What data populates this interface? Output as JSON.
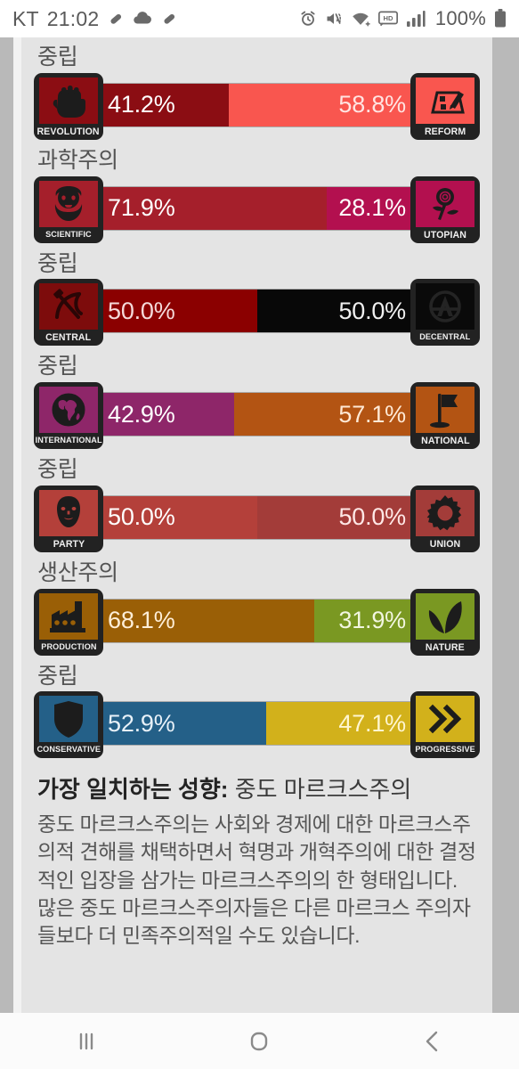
{
  "status_bar": {
    "carrier": "KT",
    "time": "21:02",
    "battery": "100%",
    "left_icons": [
      "pill-icon",
      "cloud-icon",
      "pill-icon"
    ],
    "right_icons": [
      "alarm-icon",
      "mute-icon",
      "wifi-icon",
      "hd-icon",
      "signal-icon",
      "battery-icon"
    ]
  },
  "axes": [
    {
      "name": "중립",
      "left": {
        "label": "REVOLUTION",
        "icon": "fist-icon",
        "value": "41.2%",
        "pct": 41.2,
        "color": "#8b0d13",
        "text_color": "#ffffff",
        "icon_bg": "#8b0d13",
        "icon_fg": "#1c1c1c"
      },
      "right": {
        "label": "REFORM",
        "icon": "reform-icon",
        "value": "58.8%",
        "pct": 58.8,
        "color": "#f9564f",
        "text_color": "#ffe4e2",
        "icon_bg": "#f9564f",
        "icon_fg": "#1c1c1c"
      }
    },
    {
      "name": "과학주의",
      "left": {
        "label": "SCIENTIFIC",
        "icon": "marx-icon",
        "value": "71.9%",
        "pct": 71.9,
        "color": "#a51f2b",
        "text_color": "#ffffff",
        "icon_bg": "#a51f2b",
        "icon_fg": "#1c1c1c"
      },
      "right": {
        "label": "UTOPIAN",
        "icon": "rose-icon",
        "value": "28.1%",
        "pct": 28.1,
        "color": "#b3104f",
        "text_color": "#ffffff",
        "icon_bg": "#b3104f",
        "icon_fg": "#1c1c1c"
      }
    },
    {
      "name": "중립",
      "left": {
        "label": "CENTRAL",
        "icon": "hammer-sickle-icon",
        "value": "50.0%",
        "pct": 50.0,
        "color": "#8b0000",
        "text_color": "#f5dada",
        "icon_bg": "#7d0c0c",
        "icon_fg": "#2a0606"
      },
      "right": {
        "label": "DECENTRAL",
        "icon": "anarchy-icon",
        "value": "50.0%",
        "pct": 50.0,
        "color": "#080808",
        "text_color": "#f0f0f0",
        "icon_bg": "#0a0a0a",
        "icon_fg": "#242424"
      }
    },
    {
      "name": "중립",
      "left": {
        "label": "INTERNATIONAL",
        "icon": "globe-icon",
        "value": "42.9%",
        "pct": 42.9,
        "color": "#8e2669",
        "text_color": "#ffffff",
        "icon_bg": "#8e2669",
        "icon_fg": "#1c1c1c"
      },
      "right": {
        "label": "NATIONAL",
        "icon": "flag-icon",
        "value": "57.1%",
        "pct": 57.1,
        "color": "#b35413",
        "text_color": "#ffe9d5",
        "icon_bg": "#b35413",
        "icon_fg": "#1c1c1c"
      }
    },
    {
      "name": "중립",
      "left": {
        "label": "PARTY",
        "icon": "lenin-icon",
        "value": "50.0%",
        "pct": 50.0,
        "color": "#b4403a",
        "text_color": "#ffffff",
        "icon_bg": "#b4403a",
        "icon_fg": "#1c1c1c"
      },
      "right": {
        "label": "UNION",
        "icon": "gear-icon",
        "value": "50.0%",
        "pct": 50.0,
        "color": "#a33c39",
        "text_color": "#ffe8e6",
        "icon_bg": "#a33c39",
        "icon_fg": "#1c1c1c"
      }
    },
    {
      "name": "생산주의",
      "left": {
        "label": "PRODUCTION",
        "icon": "factory-icon",
        "value": "68.1%",
        "pct": 68.1,
        "color": "#9a5f06",
        "text_color": "#ffefd8",
        "icon_bg": "#9a5f06",
        "icon_fg": "#1c1c1c"
      },
      "right": {
        "label": "NATURE",
        "icon": "leaf-icon",
        "value": "31.9%",
        "pct": 31.9,
        "color": "#7a9822",
        "text_color": "#f2f6e0",
        "icon_bg": "#7a9822",
        "icon_fg": "#1c1c1c"
      }
    },
    {
      "name": "중립",
      "left": {
        "label": "CONSERVATIVE",
        "icon": "shield-icon",
        "value": "52.9%",
        "pct": 52.9,
        "color": "#246088",
        "text_color": "#e8f1f8",
        "icon_bg": "#246088",
        "icon_fg": "#1c1c1c"
      },
      "right": {
        "label": "PROGRESSIVE",
        "icon": "double-chevron-icon",
        "value": "47.1%",
        "pct": 47.1,
        "color": "#d2b11b",
        "text_color": "#fff6d0",
        "icon_bg": "#d2b11b",
        "icon_fg": "#1c1c1c"
      }
    }
  ],
  "result": {
    "title_label": "가장 일치하는 성향:",
    "title_value": " 중도 마르크스주의",
    "description": "중도 마르크스주의는 사회와 경제에 대한 마르크스주의적 견해를 채택하면서 혁명과 개혁주의에 대한 결정적인 입장을 삼가는 마르크스주의의 한 형태입니다. 많은 중도 마르크스주의자들은 다른 마르크스 주의자들보다 더 민족주의적일 수도 있습니다."
  },
  "nav_bar": {
    "recents": "recents-icon",
    "home": "home-icon",
    "back": "back-icon"
  }
}
